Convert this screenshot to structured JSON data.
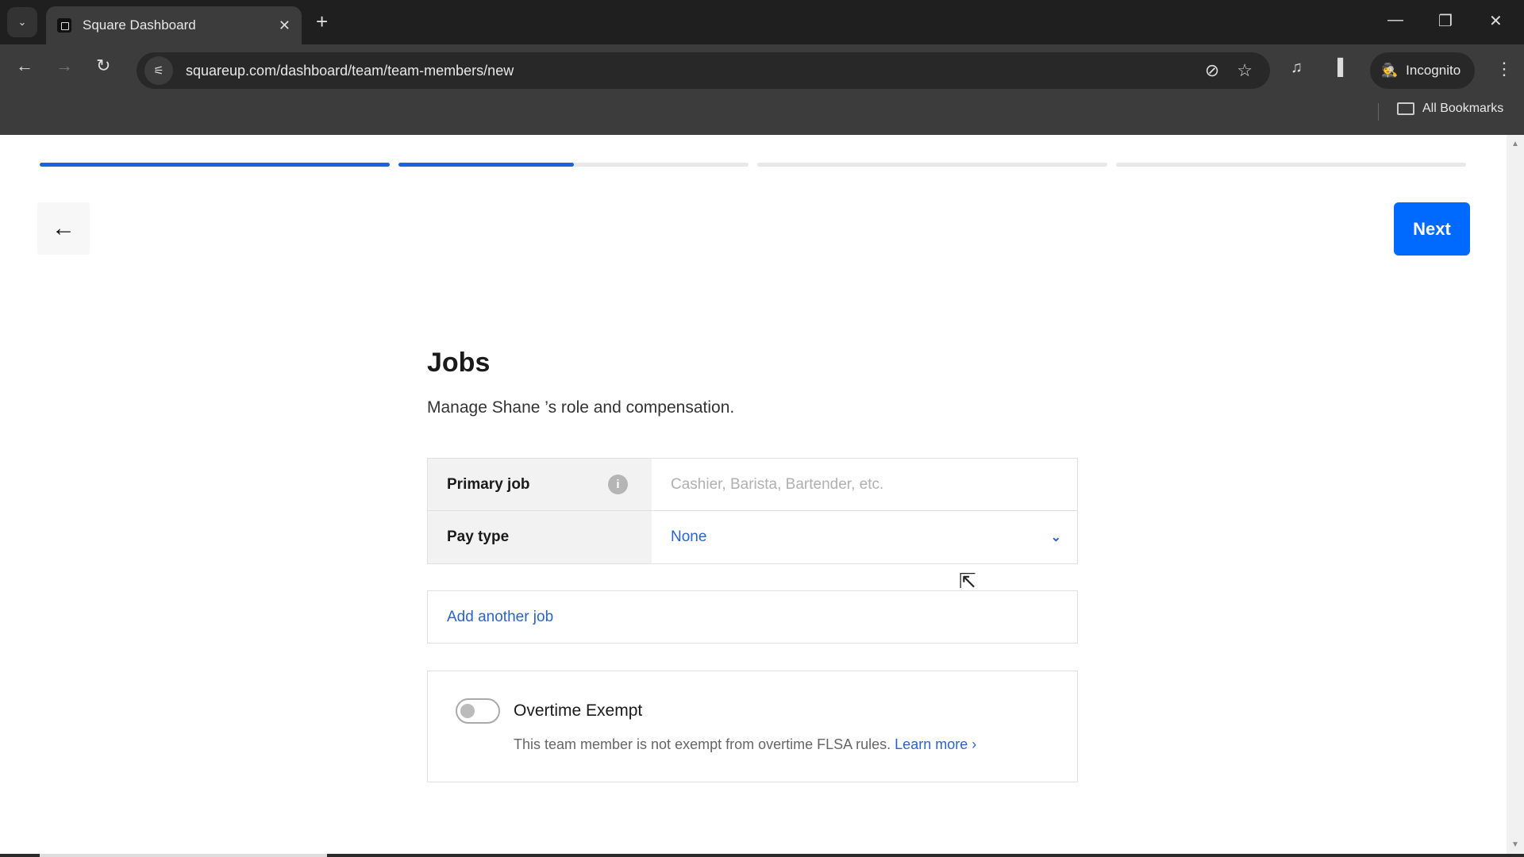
{
  "browser": {
    "tab_title": "Square Dashboard",
    "url": "squareup.com/dashboard/team/team-members/new",
    "profile_label": "Incognito",
    "bookmarks_label": "All Bookmarks",
    "icons": {
      "tab_search": "chevron-down-icon",
      "new_tab": "+",
      "close_tab": "✕",
      "minimize": "—",
      "restore": "❐",
      "close": "✕",
      "back": "←",
      "forward": "→",
      "reload": "↻",
      "site_info": "⚟",
      "eye_off": "⊘",
      "star": "☆",
      "media": "♫",
      "side_panel": "▐",
      "menu": "⋮"
    }
  },
  "wizard": {
    "steps": [
      {
        "progress": 1.0
      },
      {
        "progress": 0.5
      },
      {
        "progress": 0.0
      },
      {
        "progress": 0.0
      }
    ],
    "back_icon": "←",
    "next_label": "Next"
  },
  "jobs": {
    "title": "Jobs",
    "description": "Manage Shane ’s role and compensation.",
    "primary_job_label": "Primary job",
    "primary_job_placeholder": "Cashier, Barista, Bartender, etc.",
    "primary_job_value": "",
    "info_icon": "i",
    "pay_type_label": "Pay type",
    "pay_type_value": "None",
    "add_job_label": "Add another job"
  },
  "overtime": {
    "label": "Overtime Exempt",
    "enabled": false,
    "description": "This team member is not exempt from overtime FLSA rules.",
    "learn_more": "Learn more ›"
  },
  "colors": {
    "accent": "#006aff",
    "link": "#2c63c9",
    "progress_fill": "#1a66d6"
  }
}
